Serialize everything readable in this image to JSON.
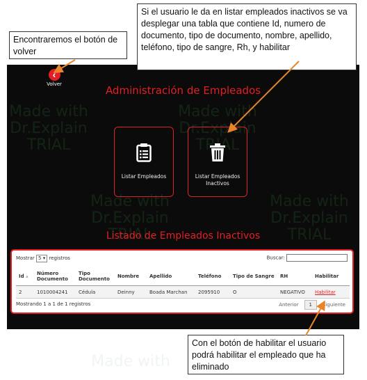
{
  "watermark": {
    "line1": "Made with",
    "line2": "Dr.Explain",
    "line3": "TRIAL"
  },
  "app": {
    "back_label": "Volver",
    "title": "Administración de Empleados",
    "cards": [
      {
        "label": "Listar Empleados",
        "icon": "clipboard-list-icon"
      },
      {
        "label_line1": "Listar Empleados",
        "label_line2": "Inactivos",
        "icon": "trash-icon"
      }
    ],
    "section_title": "Listado de Empleados Inactivos",
    "accent_color": "#e41e25"
  },
  "table": {
    "length_prefix": "Mostrar",
    "length_value": "5",
    "length_suffix": "registros",
    "search_label": "Buscar:",
    "search_value": "",
    "headers": [
      "Id",
      "Número Documento",
      "Tipo Documento",
      "Nombre",
      "Apellido",
      "Teléfono",
      "Tipo de Sangre",
      "RH",
      "Habilitar"
    ],
    "rows": [
      [
        "2",
        "1010004241",
        "Cédula",
        "Deinny",
        "Boada Marchan",
        "2095910",
        "O",
        "NEGATIVO",
        "Habilitar"
      ]
    ],
    "info": "Mostrando 1 a 1 de 1 registros",
    "prev": "Anterior",
    "page": "1",
    "next": "Siguiente"
  },
  "callouts": {
    "back": "Encontraremos el botón de volver",
    "list": "Si el usuario le da en listar empleados inactivos se va desplegar una tabla que contiene Id, numero de documento, tipo de documento, nombre, apellido, teléfono, tipo de sangre, Rh, y habilitar",
    "enable": "Con el botón de habilitar el usuario podrá habilitar el empleado que ha eliminado"
  }
}
